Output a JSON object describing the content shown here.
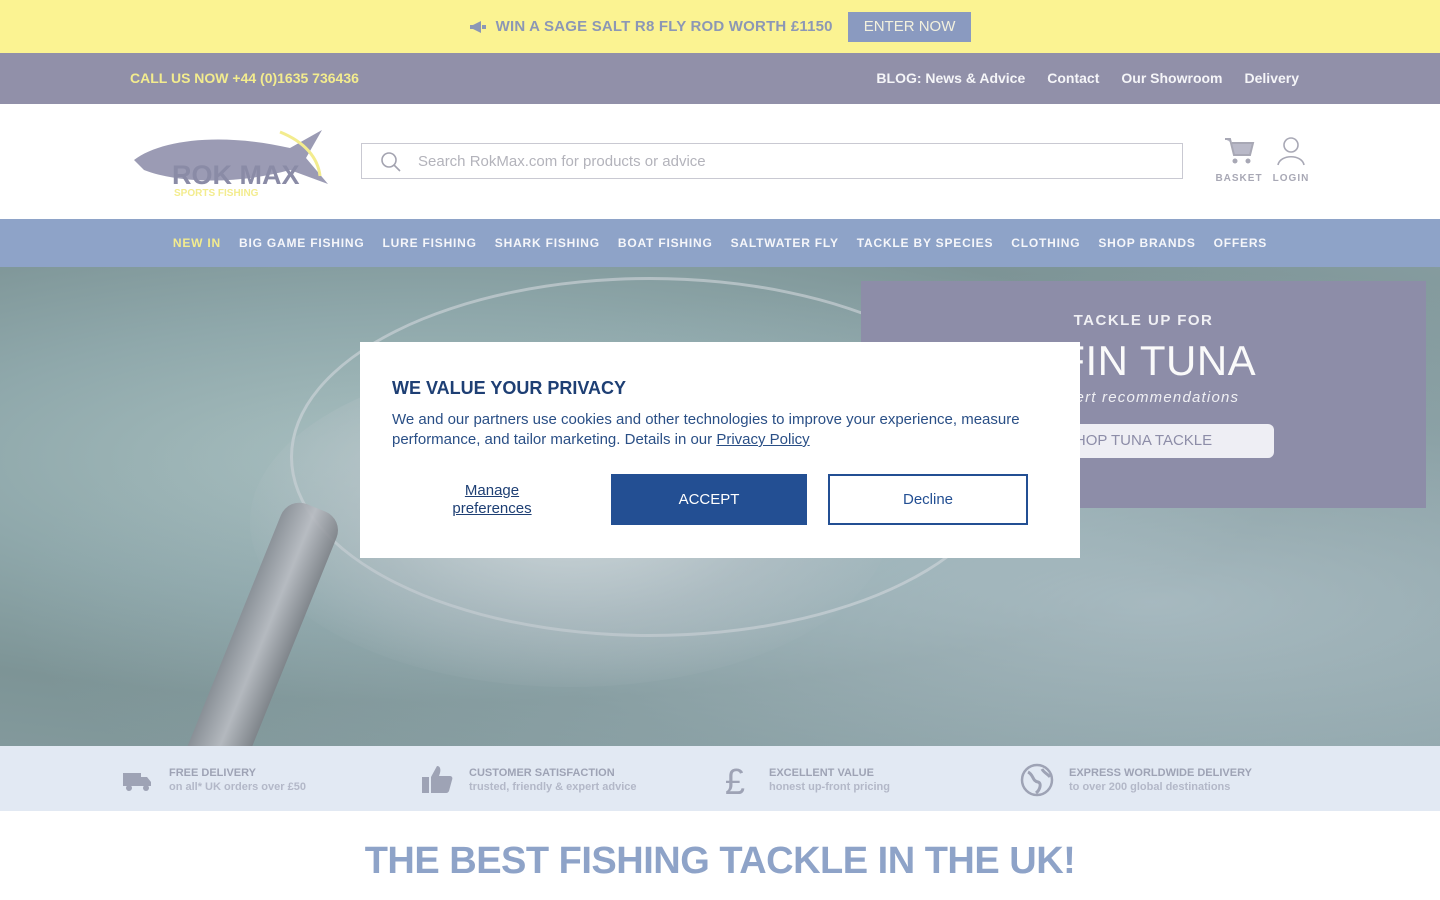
{
  "promo": {
    "text": "WIN A SAGE SALT R8 FLY ROD WORTH £1150",
    "button": "ENTER NOW",
    "icon": "megaphone-icon"
  },
  "utility": {
    "phone": "CALL US NOW +44 (0)1635 736436",
    "links": [
      "BLOG: News & Advice",
      "Contact",
      "Our Showroom",
      "Delivery"
    ]
  },
  "header": {
    "logo": {
      "word": "ROK MAX",
      "tagline": "SPORTS FISHING"
    },
    "search_placeholder": "Search RokMax.com for products or advice",
    "basket_label": "BASKET",
    "login_label": "LOGIN"
  },
  "nav": [
    "NEW IN",
    "BIG GAME FISHING",
    "LURE FISHING",
    "SHARK FISHING",
    "BOAT FISHING",
    "SALTWATER FLY",
    "TACKLE BY SPECIES",
    "CLOTHING",
    "SHOP BRANDS",
    "OFFERS"
  ],
  "hero": {
    "kicker": "TACKLE UP FOR",
    "title": "EFIN TUNA",
    "subtitle": "expert recommendations",
    "cta": "HOP TUNA TACKLE"
  },
  "privacy": {
    "title": "WE VALUE YOUR PRIVACY",
    "body": "We and our partners use cookies and other technologies to improve your experience, measure performance, and tailor marketing. Details in our ",
    "policy_link": "Privacy Policy",
    "manage": "Manage preferences",
    "accept": "ACCEPT",
    "decline": "Decline"
  },
  "features": [
    {
      "title": "FREE DELIVERY",
      "sub": "on all* UK orders over £50",
      "icon": "truck-icon"
    },
    {
      "title": "CUSTOMER SATISFACTION",
      "sub": "trusted, friendly & expert advice",
      "icon": "thumbs-up-icon"
    },
    {
      "title": "EXCELLENT VALUE",
      "sub": "honest up-front pricing",
      "icon": "pound-icon"
    },
    {
      "title": "EXPRESS WORLDWIDE DELIVERY",
      "sub": "to over 200 global destinations",
      "icon": "globe-icon"
    }
  ],
  "headline": "THE BEST FISHING TACKLE IN THE UK!",
  "colors": {
    "promo_bg": "#fbf392",
    "utility_bg": "#9190a9",
    "nav_bg": "#8ea3c8",
    "accent_yellow": "#f3ec8e",
    "modal_blue": "#234f93",
    "features_bg": "#e2e9f3"
  }
}
